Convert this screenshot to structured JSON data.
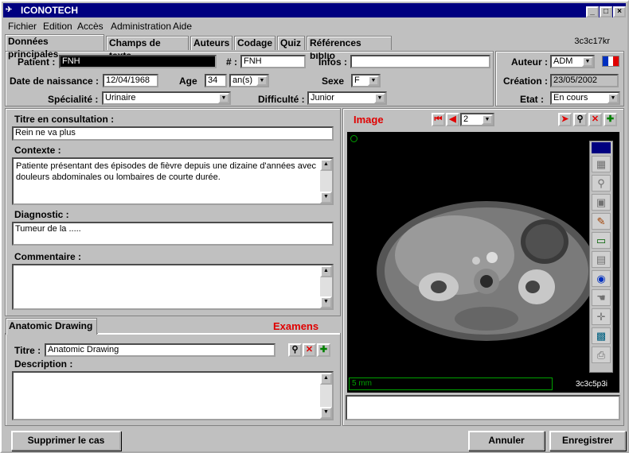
{
  "window": {
    "title": "ICONOTECH",
    "minimize": "_",
    "maximize": "□",
    "close": "×"
  },
  "menu": [
    "Fichier",
    "Edition",
    "Accès",
    "Administration",
    "Aide"
  ],
  "tabs": [
    "Données principales",
    "Champs de texte",
    "Auteurs",
    "Codage",
    "Quiz",
    "Références biblio"
  ],
  "case_code": "3c3c17kr",
  "patient": {
    "label": "Patient :",
    "value": "FNH"
  },
  "num": {
    "label": "# :",
    "value": "FNH"
  },
  "infos": {
    "label": "Infos :",
    "value": ""
  },
  "auteur": {
    "label": "Auteur :",
    "value": "ADM"
  },
  "dob": {
    "label": "Date de naissance :",
    "value": "12/04/1968"
  },
  "age": {
    "label": "Age",
    "value": "34",
    "unit": "an(s)"
  },
  "sexe": {
    "label": "Sexe",
    "value": "F"
  },
  "creation": {
    "label": "Création :",
    "value": "23/05/2002"
  },
  "specialite": {
    "label": "Spécialité :",
    "value": "Urinaire"
  },
  "difficulte": {
    "label": "Difficulté :",
    "value": "Junior"
  },
  "etat": {
    "label": "Etat :",
    "value": "En cours"
  },
  "titre_consult": {
    "label": "Titre en consultation :",
    "value": "Rein ne va plus"
  },
  "contexte": {
    "label": "Contexte :",
    "value": "Patiente présentant des épisodes de fièvre depuis une dizaine d'années avec douleurs abdominales ou lombaires de courte durée."
  },
  "diagnostic": {
    "label": "Diagnostic :",
    "value": "Tumeur de la ....."
  },
  "commentaire": {
    "label": "Commentaire :",
    "value": ""
  },
  "drawing": {
    "tab": "Anatomic Drawing",
    "examens": "Examens",
    "titre_label": "Titre :",
    "titre_value": "Anatomic Drawing",
    "desc_label": "Description :",
    "desc_value": ""
  },
  "image": {
    "label": "Image",
    "index": "2",
    "scale": "5 mm",
    "code": "3c3c5p3i"
  },
  "buttons": {
    "delete": "Supprimer le cas",
    "cancel": "Annuler",
    "save": "Enregistrer"
  },
  "colors": {
    "title_bg": "#000080",
    "accent_red": "#e00000",
    "window_bg": "#c0c0c0"
  }
}
